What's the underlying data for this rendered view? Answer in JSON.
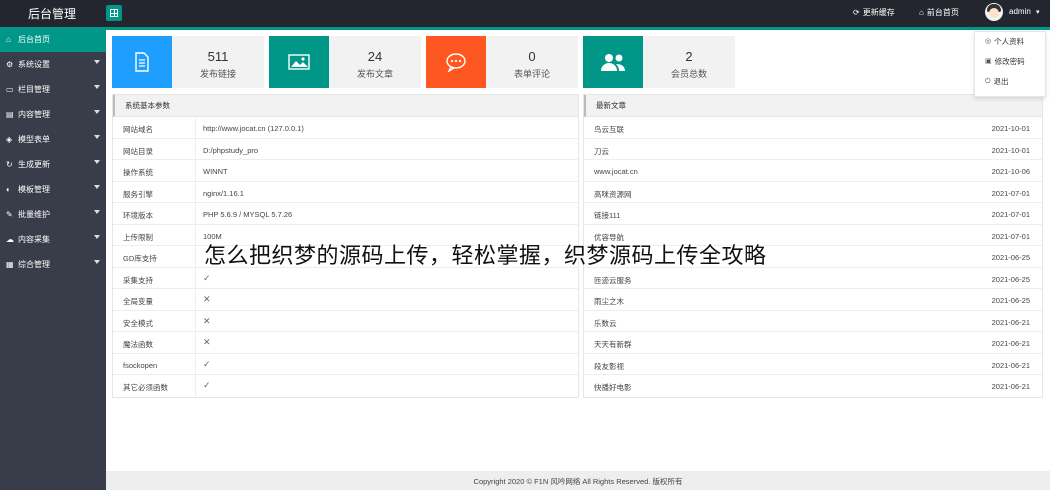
{
  "app": {
    "brand": "后台管理",
    "top_links": [
      {
        "icon": "refresh-icon",
        "label": "更新缓存"
      },
      {
        "icon": "home-icon",
        "label": "前台首页"
      }
    ],
    "user": {
      "name": "admin",
      "menu": [
        {
          "icon": "user-icon",
          "label": "个人资料"
        },
        {
          "icon": "lock-icon",
          "label": "修改密码"
        },
        {
          "icon": "logout-icon",
          "label": "退出"
        }
      ]
    }
  },
  "sidebar": {
    "items": [
      {
        "icon": "home-icon",
        "label": "后台首页",
        "active": true
      },
      {
        "icon": "gear-icon",
        "label": "系统设置"
      },
      {
        "icon": "monitor-icon",
        "label": "栏目管理"
      },
      {
        "icon": "doc-icon",
        "label": "内容管理"
      },
      {
        "icon": "cube-icon",
        "label": "模型表单"
      },
      {
        "icon": "refresh-icon",
        "label": "生成更新"
      },
      {
        "icon": "palette-icon",
        "label": "模板管理"
      },
      {
        "icon": "tools-icon",
        "label": "批量维护"
      },
      {
        "icon": "collect-icon",
        "label": "内容采集"
      },
      {
        "icon": "grid-icon",
        "label": "综合管理"
      }
    ]
  },
  "stats": [
    {
      "value": "511",
      "label": "发布链接",
      "color": "#1e9fff",
      "icon": "document-icon"
    },
    {
      "value": "24",
      "label": "发布文章",
      "color": "#009688",
      "icon": "image-icon"
    },
    {
      "value": "0",
      "label": "表单评论",
      "color": "#ff5722",
      "icon": "chat-icon"
    },
    {
      "value": "2",
      "label": "会员总数",
      "color": "#009688",
      "icon": "users-icon"
    }
  ],
  "system": {
    "title": "系统基本参数",
    "rows": [
      {
        "key": "网站域名",
        "value": "http://www.jocat.cn (127.0.0.1)"
      },
      {
        "key": "网站目录",
        "value": "D:/phpstudy_pro"
      },
      {
        "key": "操作系统",
        "value": "WINNT"
      },
      {
        "key": "服务引擎",
        "value": "nginx/1.16.1"
      },
      {
        "key": "环境版本",
        "value": "PHP 5.6.9 / MYSQL 5.7.26"
      },
      {
        "key": "上传限制",
        "value": "100M"
      },
      {
        "key": "GD库支持",
        "value": "",
        "mark": ""
      },
      {
        "key": "采集支持",
        "value": "",
        "mark": "✓"
      },
      {
        "key": "全局变量",
        "value": "",
        "mark": "✕"
      },
      {
        "key": "安全模式",
        "value": "",
        "mark": "✕"
      },
      {
        "key": "魔法函数",
        "value": "",
        "mark": "✕"
      },
      {
        "key": "fsockopen",
        "value": "",
        "mark": "✓"
      },
      {
        "key": "其它必须函数",
        "value": "",
        "mark": "✓"
      }
    ]
  },
  "latest": {
    "title": "最新文章",
    "rows": [
      {
        "title": "鸟云互联",
        "date": "2021-10-01"
      },
      {
        "title": "刀云",
        "date": "2021-10-01"
      },
      {
        "title": "www.jocat.cn",
        "date": "2021-10-06"
      },
      {
        "title": "高咪资源网",
        "date": "2021-07-01"
      },
      {
        "title": "链接111",
        "date": "2021-07-01"
      },
      {
        "title": "优容导航",
        "date": "2021-07-01"
      },
      {
        "title": "",
        "date": "2021-06-25"
      },
      {
        "title": "匝迹云服务",
        "date": "2021-06-25"
      },
      {
        "title": "雨尘之木",
        "date": "2021-06-25"
      },
      {
        "title": "乐数云",
        "date": "2021-06-21"
      },
      {
        "title": "天天有新群",
        "date": "2021-06-21"
      },
      {
        "title": "段友影视",
        "date": "2021-06-21"
      },
      {
        "title": "快播好电影",
        "date": "2021-06-21"
      }
    ]
  },
  "footer": "Copyright 2020 © F1N 风吟网络 All Rights Reserved. 版权所有",
  "overlay_text": "怎么把织梦的源码上传，轻松掌握，织梦源码上传全攻略"
}
